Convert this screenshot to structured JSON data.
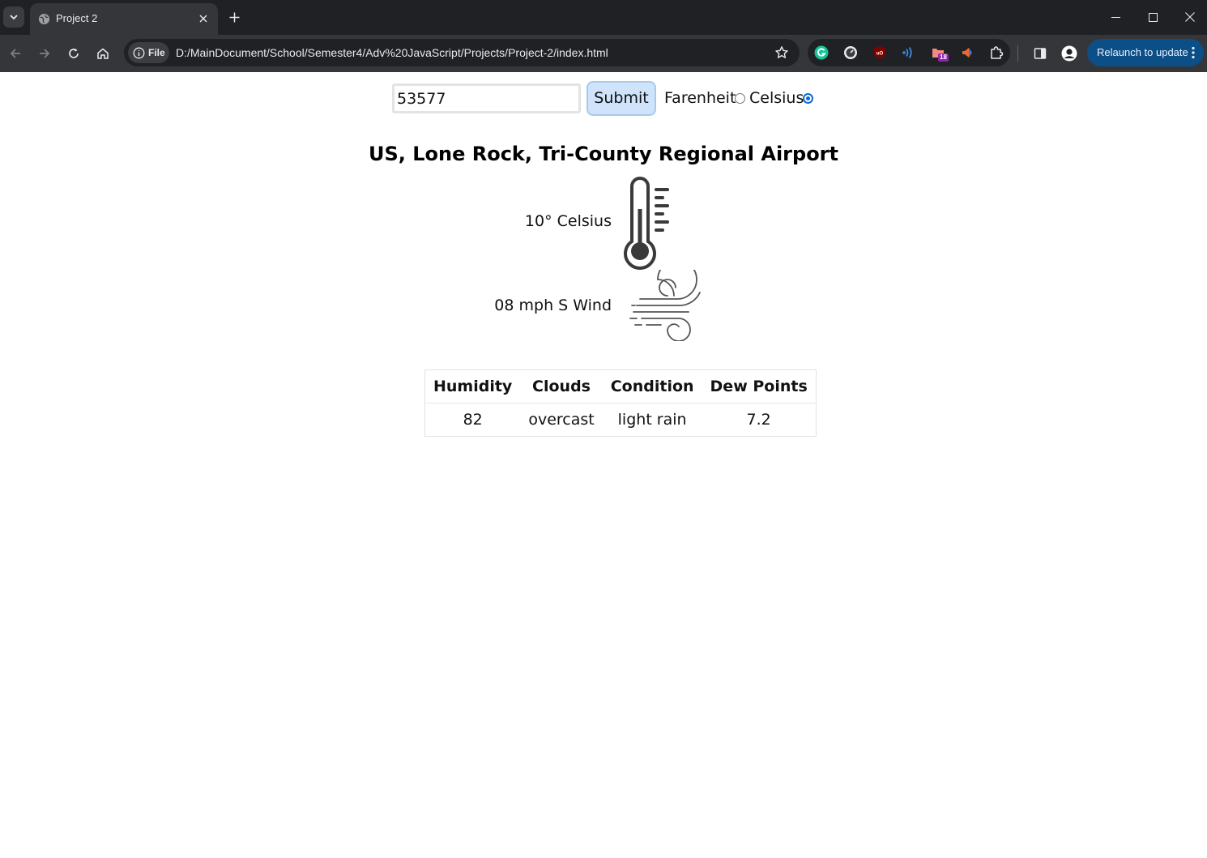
{
  "browser": {
    "tab": {
      "title": "Project 2"
    },
    "omnibox": {
      "site_info_label": "File",
      "url": "D:/MainDocument/School/Semester4/Adv%20JavaScript/Projects/Project-2/index.html"
    },
    "extensions": {
      "badge_count": "18"
    },
    "relaunch_label": "Relaunch to update",
    "colors": {
      "frame": "#202124",
      "toolbar": "#35363a",
      "relaunch": "#0c4f86"
    }
  },
  "form": {
    "zip_value": "53577",
    "submit_label": "Submit",
    "farenheit_label": "Farenheit",
    "celsius_label": "Celsius",
    "selected_unit": "Celsius"
  },
  "weather": {
    "location": "US, Lone Rock, Tri-County Regional Airport",
    "temperature": "10° Celsius",
    "wind": "08 mph S Wind",
    "table": {
      "headers": [
        "Humidity",
        "Clouds",
        "Condition",
        "Dew Points"
      ],
      "row": [
        "82",
        "overcast",
        "light rain",
        "7.2"
      ]
    }
  }
}
